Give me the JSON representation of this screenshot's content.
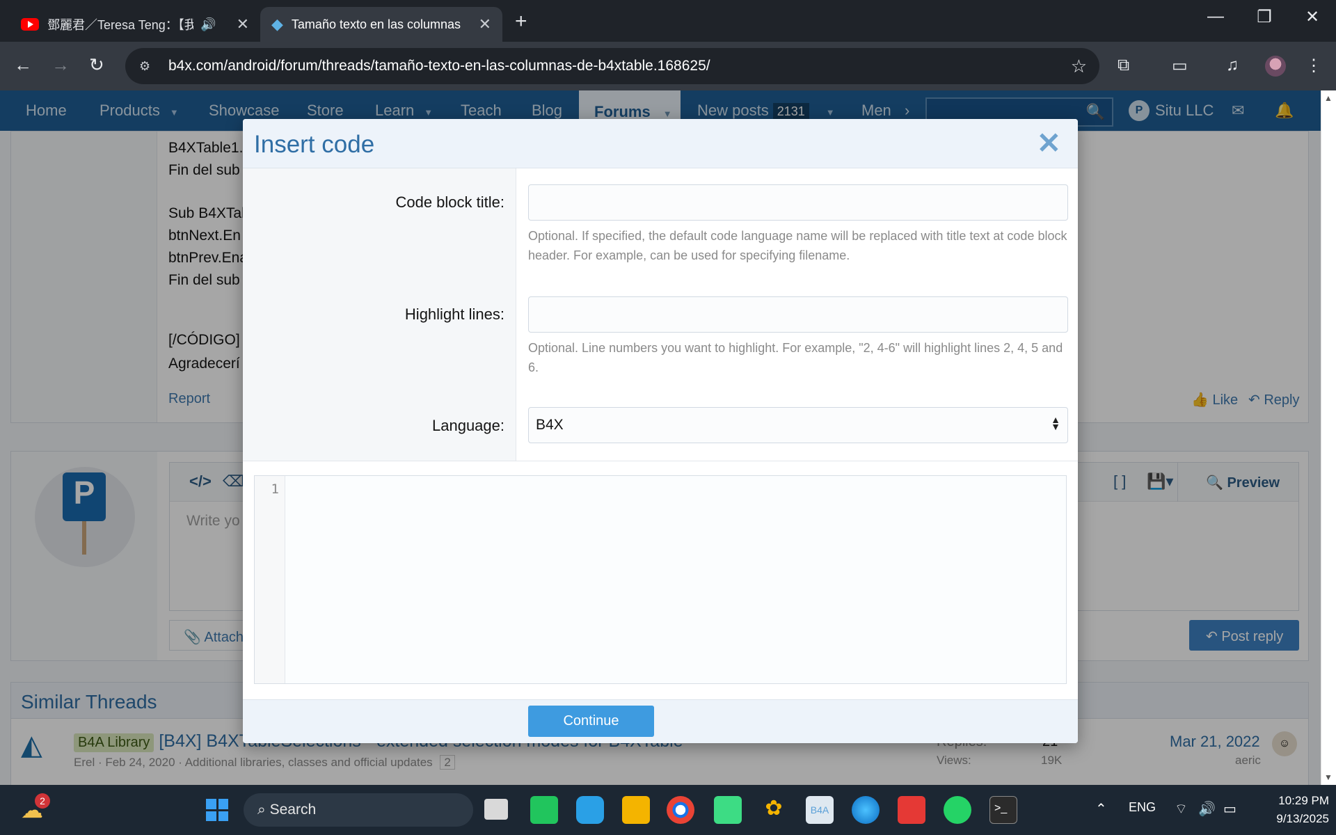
{
  "browser": {
    "tabs": [
      {
        "title": "鄧麗君／Teresa Teng：【我只",
        "active": false,
        "audio_icon": "speaker-icon"
      },
      {
        "title": "Tamaño texto en las columnas d",
        "active": true
      }
    ],
    "url": "b4x.com/android/forum/threads/tamaño-texto-en-las-columnas-de-b4xtable.168625/"
  },
  "site_nav": {
    "items": [
      "Home",
      "Products",
      "Showcase",
      "Store",
      "Learn",
      "Teach",
      "Blog"
    ],
    "forums": "Forums",
    "new_posts": "New posts",
    "new_posts_count": "2131",
    "more": "Men",
    "user": "Situ LLC"
  },
  "background_post": {
    "lines": [
      "B4XTable1.",
      "Fin del sub",
      "Sub B4XTal",
      "btnNext.En",
      "btnPrev.Ena",
      "Fin del sub",
      "[/CÓDIGO]",
      "Agradecerí"
    ],
    "report": "Report",
    "like": "Like",
    "reply": "Reply"
  },
  "reply_box": {
    "placeholder": "Write yo",
    "preview": "Preview",
    "attach": "Attach",
    "post_reply": "Post reply"
  },
  "similar_threads": {
    "title": "Similar Threads",
    "row": {
      "label": "B4A Library",
      "title": "[B4X] B4XTableSelections - extended selection modes for B4XTable",
      "meta": "Erel · Feb 24, 2020 · Additional libraries, classes and official updates",
      "pages": "2",
      "replies_label": "Replies:",
      "replies": "21",
      "views_label": "Views:",
      "views": "19K",
      "date": "Mar 21, 2022",
      "last_user": "aeric"
    }
  },
  "modal": {
    "title": "Insert code",
    "code_block_title_label": "Code block title:",
    "code_block_title_value": "",
    "code_block_title_hint": "Optional. If specified, the default code language name will be replaced with title text at code block header. For example, can be used for specifying filename.",
    "highlight_label": "Highlight lines:",
    "highlight_value": "",
    "highlight_hint": "Optional. Line numbers you want to highlight. For example, \"2, 4-6\" will highlight lines 2, 4, 5 and 6.",
    "language_label": "Language:",
    "language_value": "B4X",
    "line_number": "1",
    "continue": "Continue"
  },
  "taskbar": {
    "weather_badge": "2",
    "search": "Search",
    "lang": "ENG",
    "time": "10:29 PM",
    "date": "9/13/2025"
  },
  "colors": {
    "site_nav": "#1f5f96",
    "modal_title": "#2f6ea5",
    "continue_button": "#3e9be0",
    "post_reply_button": "#3e82c4"
  }
}
